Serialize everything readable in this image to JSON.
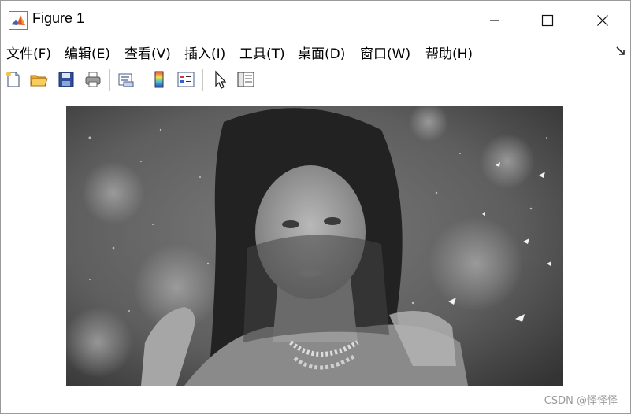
{
  "window": {
    "title": "Figure 1",
    "controls": {
      "minimize_icon": "minimize-icon",
      "maximize_icon": "maximize-icon",
      "close_icon": "close-icon"
    }
  },
  "menubar": {
    "items": [
      {
        "label": "文件(F)"
      },
      {
        "label": "编辑(E)"
      },
      {
        "label": "查看(V)"
      },
      {
        "label": "插入(I)"
      },
      {
        "label": "工具(T)"
      },
      {
        "label": "桌面(D)"
      },
      {
        "label": "窗口(W)"
      },
      {
        "label": "帮助(H)"
      }
    ],
    "dock_icon": "dock-arrow-icon"
  },
  "toolbar": {
    "buttons": [
      {
        "icon": "new-figure-icon"
      },
      {
        "icon": "open-file-icon"
      },
      {
        "icon": "save-icon"
      },
      {
        "icon": "print-icon"
      },
      {
        "icon": "link-plot-icon"
      },
      {
        "icon": "insert-colorbar-icon"
      },
      {
        "icon": "insert-legend-icon"
      },
      {
        "icon": "edit-plot-arrow-icon"
      },
      {
        "icon": "property-inspector-icon"
      }
    ]
  },
  "figure": {
    "image_description_icon": "grayscale-portrait-image",
    "watermark": "CSDN @怿怿怿"
  },
  "colors": {
    "window_bg": "#ffffff",
    "image_base": "#5a5a5a"
  }
}
